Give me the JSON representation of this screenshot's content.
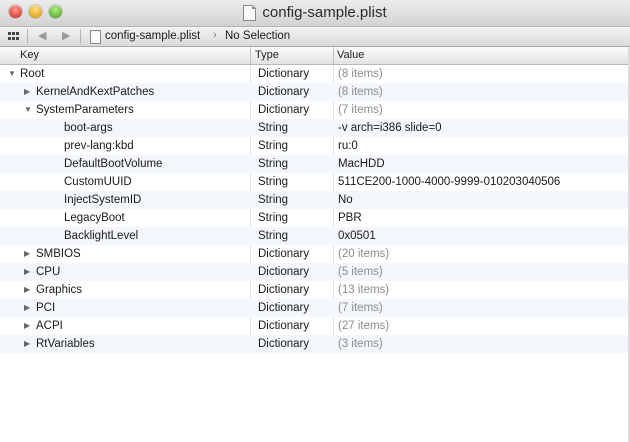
{
  "window": {
    "title": "config-sample.plist"
  },
  "navbar": {
    "back_glyph": "◀",
    "forward_glyph": "▶",
    "file_name": "config-sample.plist",
    "chevron_glyph": "›",
    "selection": "No Selection"
  },
  "columns": {
    "key": "Key",
    "type": "Type",
    "value": "Value"
  },
  "rows": [
    {
      "key": "Root",
      "type": "Dictionary",
      "value": "(8 items)",
      "level": 0,
      "disclosure": "expanded",
      "muted": true
    },
    {
      "key": "KernelAndKextPatches",
      "type": "Dictionary",
      "value": "(8 items)",
      "level": 1,
      "disclosure": "collapsed",
      "muted": true
    },
    {
      "key": "SystemParameters",
      "type": "Dictionary",
      "value": "(7 items)",
      "level": 1,
      "disclosure": "expanded",
      "muted": true
    },
    {
      "key": "boot-args",
      "type": "String",
      "value": "-v arch=i386 slide=0",
      "level": 2,
      "disclosure": "none",
      "muted": false
    },
    {
      "key": "prev-lang:kbd",
      "type": "String",
      "value": "ru:0",
      "level": 2,
      "disclosure": "none",
      "muted": false
    },
    {
      "key": "DefaultBootVolume",
      "type": "String",
      "value": "MacHDD",
      "level": 2,
      "disclosure": "none",
      "muted": false
    },
    {
      "key": "CustomUUID",
      "type": "String",
      "value": "511CE200-1000-4000-9999-010203040506",
      "level": 2,
      "disclosure": "none",
      "muted": false
    },
    {
      "key": "InjectSystemID",
      "type": "String",
      "value": "No",
      "level": 2,
      "disclosure": "none",
      "muted": false
    },
    {
      "key": "LegacyBoot",
      "type": "String",
      "value": "PBR",
      "level": 2,
      "disclosure": "none",
      "muted": false
    },
    {
      "key": "BacklightLevel",
      "type": "String",
      "value": "0x0501",
      "level": 2,
      "disclosure": "none",
      "muted": false
    },
    {
      "key": "SMBIOS",
      "type": "Dictionary",
      "value": "(20 items)",
      "level": 1,
      "disclosure": "collapsed",
      "muted": true
    },
    {
      "key": "CPU",
      "type": "Dictionary",
      "value": "(5 items)",
      "level": 1,
      "disclosure": "collapsed",
      "muted": true
    },
    {
      "key": "Graphics",
      "type": "Dictionary",
      "value": "(13 items)",
      "level": 1,
      "disclosure": "collapsed",
      "muted": true
    },
    {
      "key": "PCI",
      "type": "Dictionary",
      "value": "(7 items)",
      "level": 1,
      "disclosure": "collapsed",
      "muted": true
    },
    {
      "key": "ACPI",
      "type": "Dictionary",
      "value": "(27 items)",
      "level": 1,
      "disclosure": "collapsed",
      "muted": true
    },
    {
      "key": "RtVariables",
      "type": "Dictionary",
      "value": "(3 items)",
      "level": 1,
      "disclosure": "collapsed",
      "muted": true
    }
  ]
}
